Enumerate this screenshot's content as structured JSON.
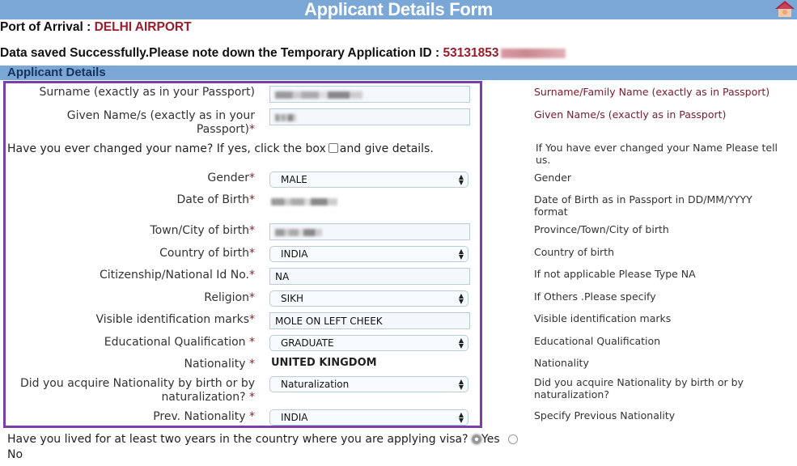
{
  "header": {
    "title": "Applicant Details Form",
    "home_icon": "home-icon"
  },
  "port": {
    "label": "Port of Arrival :",
    "value": "DELHI AIRPORT"
  },
  "saved_message": {
    "text": "Data saved Successfully.Please note down the Temporary Application ID :",
    "application_id_visible": "53131853"
  },
  "section": {
    "title": "Applicant Details"
  },
  "fields": {
    "surname": {
      "label": "Surname (exactly as in your Passport)",
      "hint": "Surname/Family Name (exactly as in Passport)"
    },
    "given_name": {
      "label_line1": "Given Name/s (exactly as in your",
      "label_line2": "Passport)",
      "required": "*",
      "hint": "Given Name/s (exactly as in Passport)"
    },
    "name_changed": {
      "text_before": "Have you ever changed your name? If yes, click the box",
      "text_after": "and give details.",
      "checked": false,
      "hint": "If You have ever changed your Name Please tell us."
    },
    "gender": {
      "label": "Gender",
      "required": "*",
      "value": "MALE",
      "hint": "Gender"
    },
    "dob": {
      "label": "Date of Birth",
      "required": "*",
      "hint": "Date of Birth as in Passport in DD/MM/YYYY format"
    },
    "town_of_birth": {
      "label": "Town/City of birth",
      "required": "*",
      "hint": "Province/Town/City of birth"
    },
    "country_of_birth": {
      "label": "Country of birth",
      "required": "*",
      "value": "INDIA",
      "hint": "Country of birth"
    },
    "national_id": {
      "label": "Citizenship/National Id No.",
      "required": "*",
      "value": "NA",
      "hint": "If not applicable Please Type NA"
    },
    "religion": {
      "label": "Religion",
      "required": "*",
      "value": "SIKH",
      "hint": "If Others .Please specify"
    },
    "visible_marks": {
      "label": "Visible identification marks",
      "required": "*",
      "value": "MOLE ON LEFT CHEEK",
      "hint": "Visible identification marks"
    },
    "education": {
      "label": "Educational Qualification",
      "required": "*",
      "value": "GRADUATE",
      "hint": "Educational Qualification"
    },
    "nationality": {
      "label": "Nationality",
      "required": "*",
      "value": "UNITED KINGDOM",
      "hint": "Nationality"
    },
    "nationality_acquired": {
      "label_line1": "Did you acquire Nationality by birth or by",
      "label_line2": "naturalization?",
      "required": "*",
      "value": "Naturalization",
      "hint": "Did you acquire Nationality by birth or by naturalization?"
    },
    "prev_nationality": {
      "label": "Prev. Nationality",
      "required": "*",
      "value": "INDIA",
      "hint": "Specify Previous Nationality"
    }
  },
  "lived_two_years": {
    "question": "Have you lived for at least two years in the country where you are applying visa?",
    "options": [
      "Yes",
      "No"
    ],
    "selected": "Yes"
  },
  "colors": {
    "header_bg": "#7ba7d6",
    "accent_red": "#9b1c2c",
    "highlight_border": "#7a3fa8"
  }
}
